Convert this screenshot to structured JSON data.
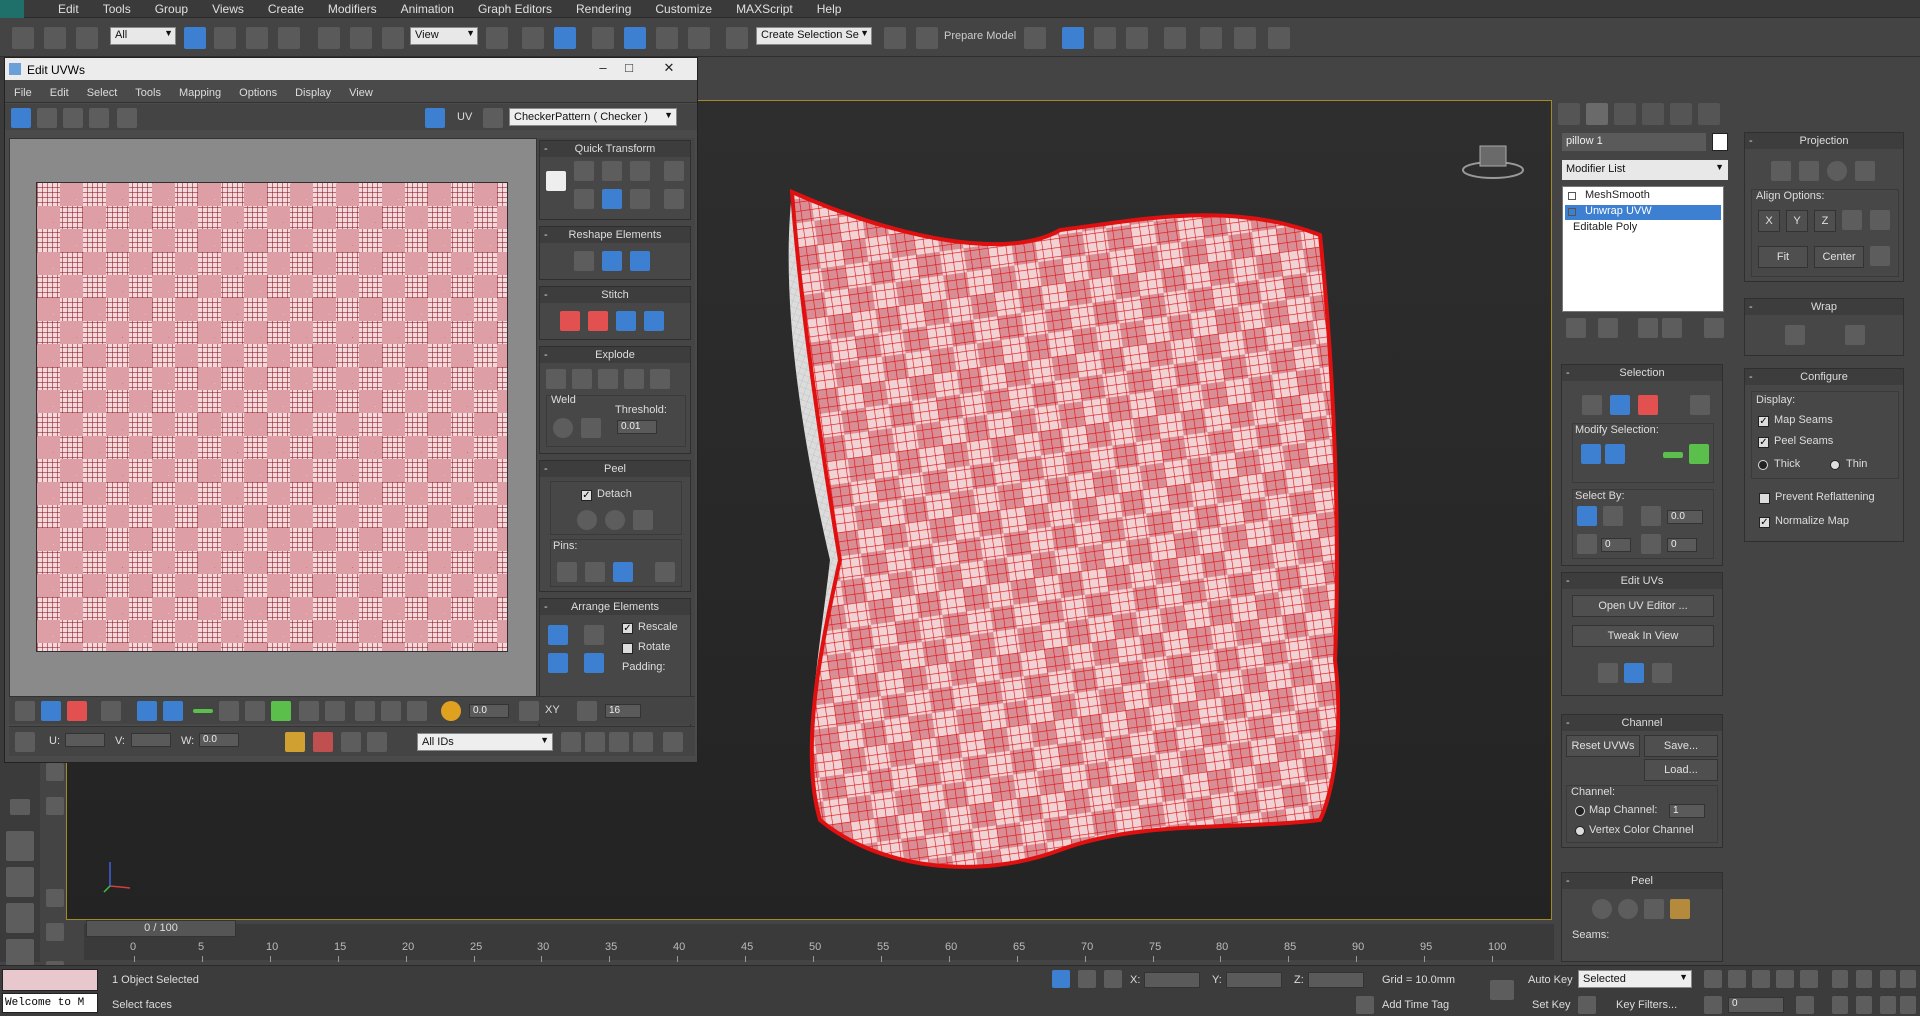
{
  "main_menu": [
    "Edit",
    "Tools",
    "Group",
    "Views",
    "Create",
    "Modifiers",
    "Animation",
    "Graph Editors",
    "Rendering",
    "Customize",
    "MAXScript",
    "Help"
  ],
  "toolbar": {
    "filter_value": "All",
    "refcoord_value": "View",
    "selection_set_placeholder": "Create Selection Se",
    "prepare_model_label": "Prepare Model"
  },
  "uv_editor": {
    "title": "Edit UVWs",
    "menu": [
      "File",
      "Edit",
      "Select",
      "Tools",
      "Mapping",
      "Options",
      "Display",
      "View"
    ],
    "uv_label": "UV",
    "texture_value": "CheckerPattern  ( Checker )",
    "rollouts": {
      "quick_transform": "Quick Transform",
      "reshape": "Reshape Elements",
      "stitch": "Stitch",
      "explode": "Explode",
      "weld": "Weld",
      "threshold_label": "Threshold:",
      "threshold_value": "0.01",
      "peel": "Peel",
      "detach_label": "Detach",
      "pins_label": "Pins:",
      "arrange": "Arrange Elements",
      "rescale_label": "Rescale",
      "rotate_label": "Rotate",
      "padding_label": "Padding:"
    },
    "bottom": {
      "soft_value": "0.0",
      "xy_label": "XY",
      "grid_value": "16",
      "u_label": "U:",
      "v_label": "V:",
      "w_label": "W:",
      "w_value": "0.0",
      "ids_value": "All IDs"
    }
  },
  "command_panel": {
    "object_name": "pillow 1",
    "modifier_list": "Modifier List",
    "stack": [
      "MeshSmooth",
      "Unwrap UVW",
      "Editable Poly"
    ],
    "selection": {
      "title": "Selection",
      "modify_selection": "Modify Selection:",
      "select_by": "Select By:",
      "angle_value": "0.0",
      "spin1_value": "0",
      "spin2_value": "0"
    },
    "edit_uvs": {
      "title": "Edit UVs",
      "open_uv_editor": "Open UV Editor ...",
      "tweak_in_view": "Tweak In View"
    },
    "channel": {
      "title": "Channel",
      "reset_uvws": "Reset UVWs",
      "save": "Save...",
      "load": "Load...",
      "channel_label": "Channel:",
      "map_channel_label": "Map Channel:",
      "map_channel_value": "1",
      "vertex_color_label": "Vertex Color Channel"
    },
    "peel": {
      "title": "Peel",
      "seams_label": "Seams:"
    },
    "projection": {
      "title": "Projection",
      "align_options": "Align Options:",
      "x": "X",
      "y": "Y",
      "z": "Z",
      "fit": "Fit",
      "center": "Center"
    },
    "wrap": {
      "title": "Wrap"
    },
    "configure": {
      "title": "Configure",
      "display_label": "Display:",
      "map_seams": "Map Seams",
      "peel_seams": "Peel Seams",
      "thick": "Thick",
      "thin": "Thin",
      "prevent_reflattening": "Prevent Reflattening",
      "normalize_map": "Normalize Map"
    }
  },
  "timeline": {
    "slider_label": "0 / 100",
    "ticks": [
      "0",
      "5",
      "10",
      "15",
      "20",
      "25",
      "30",
      "35",
      "40",
      "45",
      "50",
      "55",
      "60",
      "65",
      "70",
      "75",
      "80",
      "85",
      "90",
      "95",
      "100"
    ]
  },
  "status": {
    "welcome": "Welcome to M",
    "selected_text": "1 Object Selected",
    "prompt_text": "Select faces",
    "x_label": "X:",
    "y_label": "Y:",
    "z_label": "Z:",
    "grid_text": "Grid = 10.0mm",
    "add_time_tag": "Add Time Tag",
    "auto_key": "Auto Key",
    "set_key": "Set Key",
    "key_mode_value": "Selected",
    "key_filters": "Key Filters...",
    "frame_value": "0"
  },
  "colors": {
    "accent": "#3d7fd1",
    "checker_red": "#dd9ea6",
    "wire_red": "#e01010",
    "viewport_border": "#a08a2a"
  }
}
